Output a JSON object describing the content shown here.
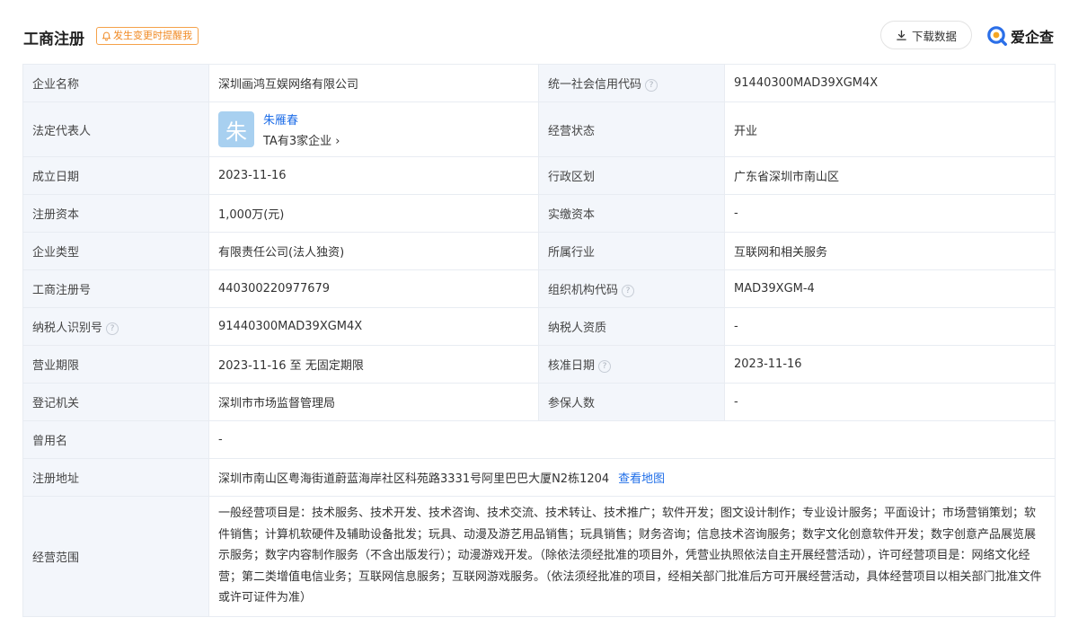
{
  "header": {
    "title": "工商注册",
    "remind_label": "发生变更时提醒我",
    "download_label": "下载数据",
    "brand_name": "爱企查",
    "accent_color": "#1f6ee8",
    "remind_color": "#f08a24",
    "icons": {
      "remind": "bell-icon",
      "download": "download-icon",
      "brand": "aiqicha-logo-icon",
      "help": "question-circle-icon",
      "chevron": "chevron-right-icon"
    }
  },
  "rows": {
    "company_name": {
      "label": "企业名称",
      "value": "深圳画鸿互娱网络有限公司"
    },
    "credit_code": {
      "label": "统一社会信用代码",
      "value": "91440300MAD39XGM4X"
    },
    "legal_rep": {
      "label": "法定代表人",
      "avatar_char": "朱",
      "name": "朱雁春",
      "companies": "TA有3家企业"
    },
    "status": {
      "label": "经营状态",
      "value": "开业"
    },
    "founded": {
      "label": "成立日期",
      "value": "2023-11-16"
    },
    "region": {
      "label": "行政区划",
      "value": "广东省深圳市南山区"
    },
    "reg_capital": {
      "label": "注册资本",
      "value": "1,000万(元)"
    },
    "paid_capital": {
      "label": "实缴资本",
      "value": "-"
    },
    "company_type": {
      "label": "企业类型",
      "value": "有限责任公司(法人独资)"
    },
    "industry": {
      "label": "所属行业",
      "value": "互联网和相关服务"
    },
    "reg_number": {
      "label": "工商注册号",
      "value": "440300220977679"
    },
    "org_code": {
      "label": "组织机构代码",
      "value": "MAD39XGM-4"
    },
    "taxpayer_id": {
      "label": "纳税人识别号",
      "value": "91440300MAD39XGM4X"
    },
    "taxpayer_qual": {
      "label": "纳税人资质",
      "value": "-"
    },
    "term": {
      "label": "营业期限",
      "value": "2023-11-16 至 无固定期限"
    },
    "approval_date": {
      "label": "核准日期",
      "value": "2023-11-16"
    },
    "authority": {
      "label": "登记机关",
      "value": "深圳市市场监督管理局"
    },
    "insured": {
      "label": "参保人数",
      "value": "-"
    },
    "former_name": {
      "label": "曾用名",
      "value": "-"
    },
    "address": {
      "label": "注册地址",
      "value": "深圳市南山区粤海街道蔚蓝海岸社区科苑路3331号阿里巴巴大厦N2栋1204",
      "map_link": "查看地图"
    },
    "scope": {
      "label": "经营范围",
      "value": "一般经营项目是：技术服务、技术开发、技术咨询、技术交流、技术转让、技术推广；软件开发；图文设计制作；专业设计服务；平面设计；市场营销策划；软件销售；计算机软硬件及辅助设备批发；玩具、动漫及游艺用品销售；玩具销售；财务咨询；信息技术咨询服务；数字文化创意软件开发；数字创意产品展览展示服务；数字内容制作服务（不含出版发行）；动漫游戏开发。（除依法须经批准的项目外，凭营业执照依法自主开展经营活动），许可经营项目是：网络文化经营；第二类增值电信业务；互联网信息服务；互联网游戏服务。（依法须经批准的项目，经相关部门批准后方可开展经营活动，具体经营项目以相关部门批准文件或许可证件为准）"
    }
  }
}
